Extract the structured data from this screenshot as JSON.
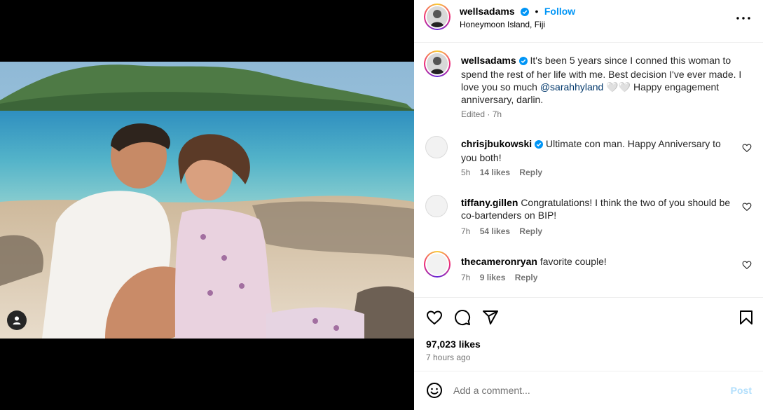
{
  "post": {
    "author": "wellsadams",
    "follow_label": "Follow",
    "location": "Honeymoon Island, Fiji",
    "caption_author": "wellsadams",
    "caption_part1": "It's been 5 years since I conned this woman to spend the rest of her life with me. Best decision I've ever made. I love you so much ",
    "caption_mention": "@sarahhyland",
    "caption_part2": " 🤍🤍 Happy engagement anniversary, darlin.",
    "caption_meta": "Edited · 7h"
  },
  "comments": [
    {
      "user": "chrisjbukowski",
      "verified": true,
      "text": "Ultimate con man. Happy Anniversary to you both!",
      "time": "5h",
      "likes": "14 likes",
      "reply": "Reply"
    },
    {
      "user": "tiffany.gillen",
      "verified": false,
      "text": "Congratulations! I think the two of you should be co-bartenders on BIP!",
      "time": "7h",
      "likes": "54 likes",
      "reply": "Reply"
    },
    {
      "user": "thecameronryan",
      "verified": false,
      "text": "favorite couple!",
      "time": "7h",
      "likes": "9 likes",
      "reply": "Reply"
    }
  ],
  "actions": {
    "likes": "97,023 likes",
    "time_ago": "7 hours ago"
  },
  "add_comment": {
    "placeholder": "Add a comment...",
    "post_label": "Post"
  },
  "icons": {
    "like": "heart-icon",
    "comment": "comment-bubble-icon",
    "share": "paper-plane-icon",
    "save": "bookmark-icon",
    "more": "more-options-icon",
    "tag": "user-tag-icon",
    "emoji": "emoji-icon",
    "verified": "verified-badge-icon"
  },
  "colors": {
    "accent": "#0095f6",
    "verified": "#0095f6",
    "mention": "#00376b",
    "post_disabled": "#b2dffc"
  }
}
